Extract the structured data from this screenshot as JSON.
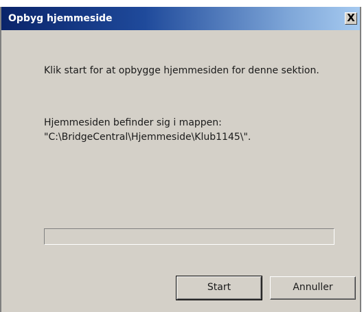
{
  "window": {
    "title": "Opbyg hjemmeside",
    "close_label": "X"
  },
  "message": {
    "line1": "Klik start for at opbygge hjemmesiden for denne sektion.",
    "line2": "Hjemmesiden befinder sig i mappen: \"C:\\BridgeCentral\\Hjemmeside\\Klub1145\\\"."
  },
  "progress": {
    "value": 0
  },
  "buttons": {
    "start_label": "Start",
    "cancel_label": "Annuller"
  }
}
